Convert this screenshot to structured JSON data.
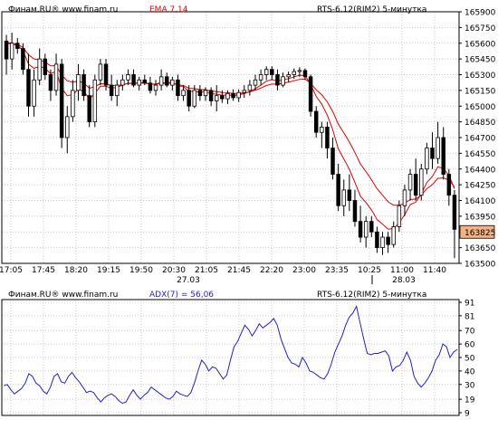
{
  "colors": {
    "background": "#ffffff",
    "frame": "#000000",
    "grid": "#c8c8c8",
    "ema": "#e00000",
    "adx": "#2020d0",
    "candle": "#000000",
    "header_text": "#000000",
    "last_price_box": "#f4b183"
  },
  "chart_data": [
    {
      "type": "candlestick",
      "header": {
        "source": "Финам.RU®  www.finam.ru",
        "indicator": "EMA 7,14",
        "instrument": "RTS-6.12(RIM2) 5-минутка"
      },
      "yticks": [
        165900,
        165750,
        165600,
        165450,
        165300,
        165150,
        165000,
        164850,
        164700,
        164550,
        164400,
        164250,
        164100,
        163950,
        163800,
        163650,
        163500
      ],
      "ytick_labels": [
        "165900",
        "165750",
        "165600",
        "165450",
        "165300",
        "165150",
        "165000",
        "164850",
        "164700",
        "164550",
        "164400",
        "164250",
        "164100",
        "163950",
        "163825",
        "163650",
        "163500"
      ],
      "ylim": [
        163500,
        165900
      ],
      "xtick_labels": [
        "17:05",
        "17:45",
        "18:20",
        "19:15",
        "19:50",
        "20:30",
        "21:05",
        "21:45",
        "22:20",
        "23:00",
        "23:35",
        "10:25",
        "11:00",
        "11:40"
      ],
      "date_labels": [
        "27.03",
        "28.03"
      ],
      "last_price": "163825",
      "candles": [
        {
          "o": 165620,
          "h": 165680,
          "l": 165300,
          "c": 165450
        },
        {
          "o": 165450,
          "h": 165700,
          "l": 165350,
          "c": 165600
        },
        {
          "o": 165600,
          "h": 165650,
          "l": 165500,
          "c": 165550
        },
        {
          "o": 165550,
          "h": 165600,
          "l": 165300,
          "c": 165350
        },
        {
          "o": 165350,
          "h": 165500,
          "l": 164900,
          "c": 165000
        },
        {
          "o": 165000,
          "h": 165350,
          "l": 164900,
          "c": 165250
        },
        {
          "o": 165250,
          "h": 165550,
          "l": 165200,
          "c": 165450
        },
        {
          "o": 165450,
          "h": 165500,
          "l": 165250,
          "c": 165300
        },
        {
          "o": 165300,
          "h": 165350,
          "l": 165050,
          "c": 165150
        },
        {
          "o": 165150,
          "h": 165500,
          "l": 165100,
          "c": 165400
        },
        {
          "o": 165400,
          "h": 165450,
          "l": 164600,
          "c": 164700
        },
        {
          "o": 164700,
          "h": 165000,
          "l": 164550,
          "c": 164900
        },
        {
          "o": 164900,
          "h": 165250,
          "l": 164850,
          "c": 165150
        },
        {
          "o": 165150,
          "h": 165400,
          "l": 165050,
          "c": 165300
        },
        {
          "o": 165300,
          "h": 165350,
          "l": 165050,
          "c": 165100
        },
        {
          "o": 165100,
          "h": 165200,
          "l": 164800,
          "c": 164850
        },
        {
          "o": 164850,
          "h": 165300,
          "l": 164800,
          "c": 165250
        },
        {
          "o": 165250,
          "h": 165450,
          "l": 165200,
          "c": 165400
        },
        {
          "o": 165400,
          "h": 165450,
          "l": 165150,
          "c": 165200
        },
        {
          "o": 165200,
          "h": 165300,
          "l": 165050,
          "c": 165100
        },
        {
          "o": 165100,
          "h": 165250,
          "l": 165000,
          "c": 165200
        },
        {
          "o": 165200,
          "h": 165300,
          "l": 165150,
          "c": 165250
        },
        {
          "o": 165250,
          "h": 165350,
          "l": 165200,
          "c": 165300
        },
        {
          "o": 165300,
          "h": 165350,
          "l": 165180,
          "c": 165200
        },
        {
          "o": 165200,
          "h": 165280,
          "l": 165150,
          "c": 165250
        },
        {
          "o": 165250,
          "h": 165300,
          "l": 165200,
          "c": 165220
        },
        {
          "o": 165220,
          "h": 165280,
          "l": 165120,
          "c": 165150
        },
        {
          "o": 165150,
          "h": 165250,
          "l": 165100,
          "c": 165200
        },
        {
          "o": 165200,
          "h": 165350,
          "l": 165150,
          "c": 165280
        },
        {
          "o": 165280,
          "h": 165320,
          "l": 165180,
          "c": 165200
        },
        {
          "o": 165200,
          "h": 165280,
          "l": 165150,
          "c": 165250
        },
        {
          "o": 165250,
          "h": 165300,
          "l": 165050,
          "c": 165100
        },
        {
          "o": 165100,
          "h": 165200,
          "l": 165050,
          "c": 165150
        },
        {
          "o": 165150,
          "h": 165200,
          "l": 164950,
          "c": 165000
        },
        {
          "o": 165000,
          "h": 165200,
          "l": 164980,
          "c": 165150
        },
        {
          "o": 165150,
          "h": 165200,
          "l": 165050,
          "c": 165100
        },
        {
          "o": 165100,
          "h": 165180,
          "l": 165050,
          "c": 165150
        },
        {
          "o": 165150,
          "h": 165180,
          "l": 165000,
          "c": 165050
        },
        {
          "o": 165050,
          "h": 165200,
          "l": 164950,
          "c": 165100
        },
        {
          "o": 165100,
          "h": 165150,
          "l": 165030,
          "c": 165070
        },
        {
          "o": 165070,
          "h": 165150,
          "l": 165020,
          "c": 165120
        },
        {
          "o": 165120,
          "h": 165160,
          "l": 165050,
          "c": 165080
        },
        {
          "o": 165080,
          "h": 165160,
          "l": 165040,
          "c": 165130
        },
        {
          "o": 165130,
          "h": 165200,
          "l": 165080,
          "c": 165150
        },
        {
          "o": 165150,
          "h": 165250,
          "l": 165100,
          "c": 165200
        },
        {
          "o": 165200,
          "h": 165300,
          "l": 165150,
          "c": 165250
        },
        {
          "o": 165250,
          "h": 165350,
          "l": 165200,
          "c": 165300
        },
        {
          "o": 165300,
          "h": 165380,
          "l": 165250,
          "c": 165350
        },
        {
          "o": 165350,
          "h": 165380,
          "l": 165250,
          "c": 165300
        },
        {
          "o": 165300,
          "h": 165350,
          "l": 165150,
          "c": 165200
        },
        {
          "o": 165200,
          "h": 165320,
          "l": 165180,
          "c": 165280
        },
        {
          "o": 165280,
          "h": 165330,
          "l": 165230,
          "c": 165300
        },
        {
          "o": 165300,
          "h": 165360,
          "l": 165260,
          "c": 165330
        },
        {
          "o": 165330,
          "h": 165370,
          "l": 165280,
          "c": 165340
        },
        {
          "o": 165340,
          "h": 165360,
          "l": 165250,
          "c": 165280
        },
        {
          "o": 165280,
          "h": 165300,
          "l": 164900,
          "c": 164950
        },
        {
          "o": 164950,
          "h": 165000,
          "l": 164700,
          "c": 164750
        },
        {
          "o": 164750,
          "h": 164850,
          "l": 164600,
          "c": 164800
        },
        {
          "o": 164800,
          "h": 164850,
          "l": 164500,
          "c": 164600
        },
        {
          "o": 164600,
          "h": 164700,
          "l": 164300,
          "c": 164350
        },
        {
          "o": 164350,
          "h": 164450,
          "l": 164000,
          "c": 164050
        },
        {
          "o": 164050,
          "h": 164300,
          "l": 163950,
          "c": 164200
        },
        {
          "o": 164200,
          "h": 164350,
          "l": 164000,
          "c": 164100
        },
        {
          "o": 164100,
          "h": 164200,
          "l": 163850,
          "c": 163900
        },
        {
          "o": 163900,
          "h": 164050,
          "l": 163700,
          "c": 163750
        },
        {
          "o": 163750,
          "h": 163950,
          "l": 163650,
          "c": 163900
        },
        {
          "o": 163900,
          "h": 163950,
          "l": 163750,
          "c": 163800
        },
        {
          "o": 163800,
          "h": 163850,
          "l": 163600,
          "c": 163650
        },
        {
          "o": 163650,
          "h": 163800,
          "l": 163580,
          "c": 163750
        },
        {
          "o": 163750,
          "h": 163800,
          "l": 163600,
          "c": 163680
        },
        {
          "o": 163680,
          "h": 163900,
          "l": 163650,
          "c": 163850
        },
        {
          "o": 163850,
          "h": 164100,
          "l": 163800,
          "c": 164050
        },
        {
          "o": 164050,
          "h": 164250,
          "l": 163950,
          "c": 164200
        },
        {
          "o": 164200,
          "h": 164400,
          "l": 164100,
          "c": 164350
        },
        {
          "o": 164350,
          "h": 164500,
          "l": 164100,
          "c": 164150
        },
        {
          "o": 164150,
          "h": 164450,
          "l": 164100,
          "c": 164400
        },
        {
          "o": 164400,
          "h": 164650,
          "l": 164350,
          "c": 164600
        },
        {
          "o": 164600,
          "h": 164750,
          "l": 164400,
          "c": 164500
        },
        {
          "o": 164500,
          "h": 164850,
          "l": 164450,
          "c": 164700
        },
        {
          "o": 164700,
          "h": 164800,
          "l": 164300,
          "c": 164350
        },
        {
          "o": 164350,
          "h": 164400,
          "l": 164050,
          "c": 164150
        },
        {
          "o": 164150,
          "h": 164200,
          "l": 163550,
          "c": 163825
        }
      ],
      "ema_series": [
        {
          "name": "EMA 7",
          "values": [
            165600,
            165590,
            165580,
            165530,
            165400,
            165360,
            165380,
            165360,
            165310,
            165330,
            165170,
            165100,
            165110,
            165160,
            165140,
            165070,
            165120,
            165190,
            165190,
            165170,
            165180,
            165200,
            165220,
            165215,
            165225,
            165225,
            165210,
            165210,
            165225,
            165220,
            165228,
            165195,
            165185,
            165140,
            165142,
            165132,
            165138,
            165118,
            165114,
            165103,
            165108,
            165101,
            165108,
            165119,
            165139,
            165167,
            165200,
            165238,
            165253,
            165240,
            165250,
            165263,
            165280,
            165295,
            165292,
            165207,
            165093,
            165020,
            164915,
            164774,
            164593,
            164495,
            164396,
            164272,
            164141,
            164080,
            164010,
            163917,
            163875,
            163826,
            163832,
            163886,
            163965,
            164061,
            164084,
            164163,
            164272,
            164329,
            164422,
            164404,
            164341,
            164212
          ]
        },
        {
          "name": "EMA 14",
          "values": [
            165610,
            165600,
            165590,
            165560,
            165490,
            165450,
            165440,
            165420,
            165384,
            165386,
            165294,
            165241,
            165229,
            165238,
            165220,
            165171,
            165185,
            165214,
            165212,
            165197,
            165197,
            165204,
            165217,
            165215,
            165219,
            165219,
            165210,
            165208,
            165218,
            165215,
            165220,
            165203,
            165196,
            165170,
            165167,
            165158,
            165157,
            165143,
            165138,
            165129,
            165128,
            165121,
            165122,
            165126,
            165136,
            165152,
            165172,
            165196,
            165210,
            165209,
            165218,
            165229,
            165242,
            165255,
            165258,
            165218,
            165156,
            165109,
            165041,
            164949,
            164829,
            164744,
            164658,
            164556,
            164448,
            164375,
            164298,
            164212,
            164150,
            164087,
            164055,
            164054,
            164073,
            164109,
            164114,
            164152,
            164212,
            164251,
            164311,
            164316,
            164294,
            164231
          ]
        }
      ]
    },
    {
      "type": "line",
      "header": {
        "source": "Финам.RU®  www.finam.ru",
        "indicator": "ADX(7) = 56,06",
        "instrument": "RTS-6.12(RIM2) 5-минутка"
      },
      "name": "ADX(7)",
      "yticks": [
        91,
        81,
        70,
        60,
        50,
        40,
        30,
        19,
        9
      ],
      "ylim": [
        9,
        91
      ],
      "values": [
        29,
        30,
        26,
        23,
        25,
        27,
        31,
        38,
        36,
        31,
        29,
        25,
        23,
        28,
        36,
        38,
        32,
        31,
        36,
        39,
        35,
        32,
        28,
        24,
        25,
        24,
        20,
        17,
        20,
        22,
        23,
        21,
        18,
        16,
        17,
        22,
        26,
        22,
        19,
        22,
        24,
        28,
        26,
        24,
        22,
        20,
        19,
        21,
        25,
        23,
        22,
        21,
        24,
        31,
        40,
        48,
        45,
        40,
        43,
        42,
        38,
        34,
        37,
        48,
        58,
        62,
        68,
        74,
        71,
        66,
        70,
        75,
        72,
        74,
        76,
        79,
        74,
        64,
        57,
        50,
        46,
        45,
        43,
        50,
        46,
        40,
        39,
        37,
        35,
        34,
        38,
        45,
        54,
        60,
        66,
        74,
        80,
        83,
        88,
        76,
        64,
        53,
        52,
        53,
        53,
        54,
        55,
        51,
        40,
        43,
        44,
        48,
        54,
        48,
        36,
        31,
        28,
        31,
        35,
        40,
        48,
        52,
        60,
        58,
        50,
        54,
        56
      ]
    }
  ]
}
